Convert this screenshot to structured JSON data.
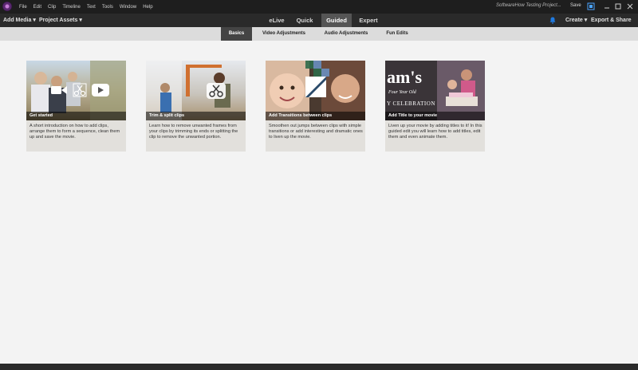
{
  "menu": [
    "File",
    "Edit",
    "Clip",
    "Timeline",
    "Text",
    "Tools",
    "Window",
    "Help"
  ],
  "window": {
    "project_title": "SoftwareHow Testing Project...",
    "save_label": "Save"
  },
  "toolbar": {
    "add_media": "Add Media",
    "project_assets": "Project Assets",
    "create": "Create",
    "export": "Export & Share"
  },
  "modes": [
    "eLive",
    "Quick",
    "Guided",
    "Expert"
  ],
  "active_mode": "Guided",
  "subtabs": [
    "Basics",
    "Video Adjustments",
    "Audio Adjustments",
    "Fun Edits"
  ],
  "active_subtab": "Basics",
  "cards": [
    {
      "title": "Get started",
      "desc": "A short introduction on how to add clips, arrange them to form a sequence, clean them up and save the movie.",
      "icons": [
        "video-camera-icon",
        "scissors-icon",
        "play-icon"
      ]
    },
    {
      "title": "Trim & split clips",
      "desc": "Learn how to remove unwanted frames from your clips by trimming its ends or splitting the clip to remove the unwanted portion.",
      "icons": [
        "scissors-icon"
      ]
    },
    {
      "title": "Add Transitions between clips",
      "desc": "Smoothen out jumps between clips with simple transitions or add interesting and dramatic ones to liven up the movie.",
      "icons": [
        "transition-icon"
      ]
    },
    {
      "title": "Add Title to your movie",
      "desc": "Liven up your movie by adding titles to it! In this guided edit you will learn how to add titles, edit them and even animate them.",
      "overlay_lines": [
        "am's",
        "Four Year Old",
        "Y CELEBRATION"
      ]
    }
  ],
  "colors": {
    "titlebar": "#1e1e1e",
    "toolbar": "#2a2a2a",
    "active_tab": "#555555",
    "accent": "#1f7ae0"
  }
}
